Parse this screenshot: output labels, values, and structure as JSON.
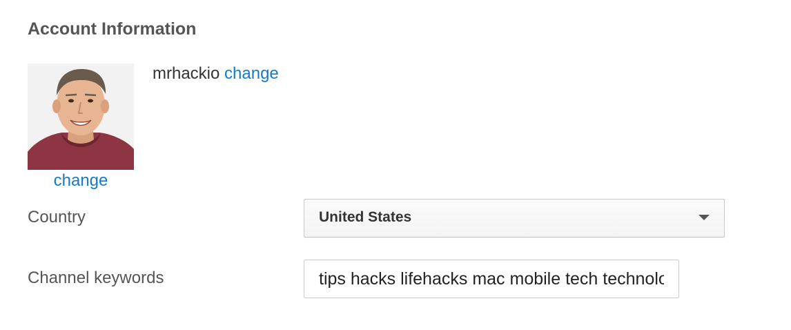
{
  "section": {
    "title": "Account Information"
  },
  "avatar": {
    "change_label": "change"
  },
  "account": {
    "username": "mrhackio",
    "change_label": "change"
  },
  "country": {
    "label": "Country",
    "selected": "United States"
  },
  "keywords": {
    "label": "Channel keywords",
    "value": "tips hacks lifehacks mac mobile tech technology"
  },
  "colors": {
    "link": "#167ac6",
    "title": "#555555",
    "border": "#c8c8c8"
  },
  "icons": {
    "dropdown": "chevron-down-icon"
  }
}
